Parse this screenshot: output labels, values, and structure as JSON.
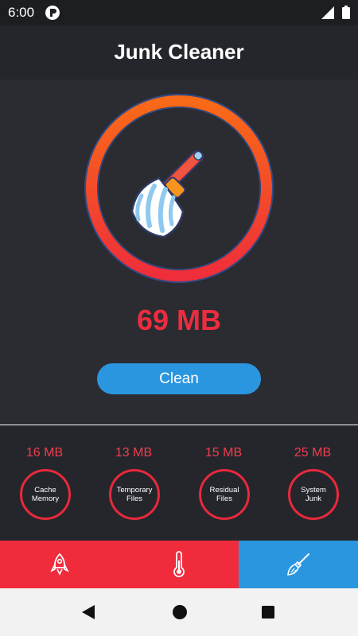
{
  "status_bar": {
    "time": "6:00",
    "app_icon": "app-logo-icon",
    "signal_icon": "signal-icon",
    "battery_icon": "battery-icon"
  },
  "header": {
    "title": "Junk Cleaner"
  },
  "gauge": {
    "icon": "broom-icon",
    "junk_total": "69 MB"
  },
  "actions": {
    "clean_label": "Clean"
  },
  "categories": [
    {
      "size": "16 MB",
      "label": "Cache Memory"
    },
    {
      "size": "13 MB",
      "label": "Temporary Files"
    },
    {
      "size": "15 MB",
      "label": "Residual Files"
    },
    {
      "size": "25 MB",
      "label": "System Junk"
    }
  ],
  "bottom_nav": [
    {
      "icon": "rocket-icon",
      "active": false
    },
    {
      "icon": "thermometer-icon",
      "active": false
    },
    {
      "icon": "broom-icon",
      "active": true
    }
  ],
  "colors": {
    "accent_red": "#ef2b3c",
    "accent_blue": "#2b96e0",
    "ring_orange": "#f7651c",
    "background": "#25262b"
  }
}
